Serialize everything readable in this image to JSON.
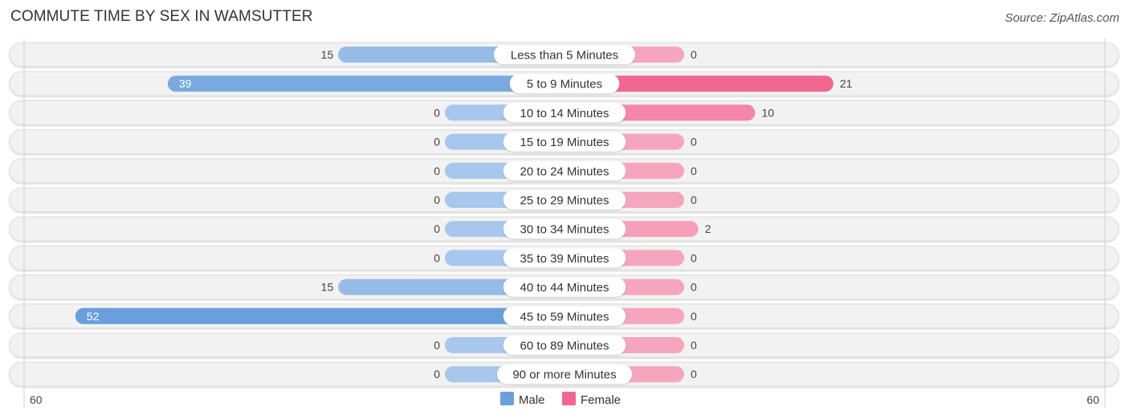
{
  "header": {
    "title": "COMMUTE TIME BY SEX IN WAMSUTTER",
    "source": "Source: ZipAtlas.com"
  },
  "colors": {
    "male": "#6a9fdc",
    "male_light": "#a8c7ec",
    "female": "#f06792",
    "female_light": "#f5a6be",
    "row_bg": "#f2f2f2"
  },
  "chart_data": {
    "type": "bar",
    "orientation": "horizontal-diverging",
    "title": "COMMUTE TIME BY SEX IN WAMSUTTER",
    "categories": [
      "Less than 5 Minutes",
      "5 to 9 Minutes",
      "10 to 14 Minutes",
      "15 to 19 Minutes",
      "20 to 24 Minutes",
      "25 to 29 Minutes",
      "30 to 34 Minutes",
      "35 to 39 Minutes",
      "40 to 44 Minutes",
      "45 to 59 Minutes",
      "60 to 89 Minutes",
      "90 or more Minutes"
    ],
    "series": [
      {
        "name": "Male",
        "values": [
          15,
          39,
          0,
          0,
          0,
          0,
          0,
          0,
          15,
          52,
          0,
          0
        ]
      },
      {
        "name": "Female",
        "values": [
          0,
          21,
          10,
          0,
          0,
          0,
          2,
          0,
          0,
          0,
          0,
          0
        ]
      }
    ],
    "axis": {
      "left_label": "60",
      "right_label": "60",
      "max": 60
    },
    "legend": {
      "position": "bottom-center",
      "items": [
        "Male",
        "Female"
      ]
    },
    "grid": false
  }
}
